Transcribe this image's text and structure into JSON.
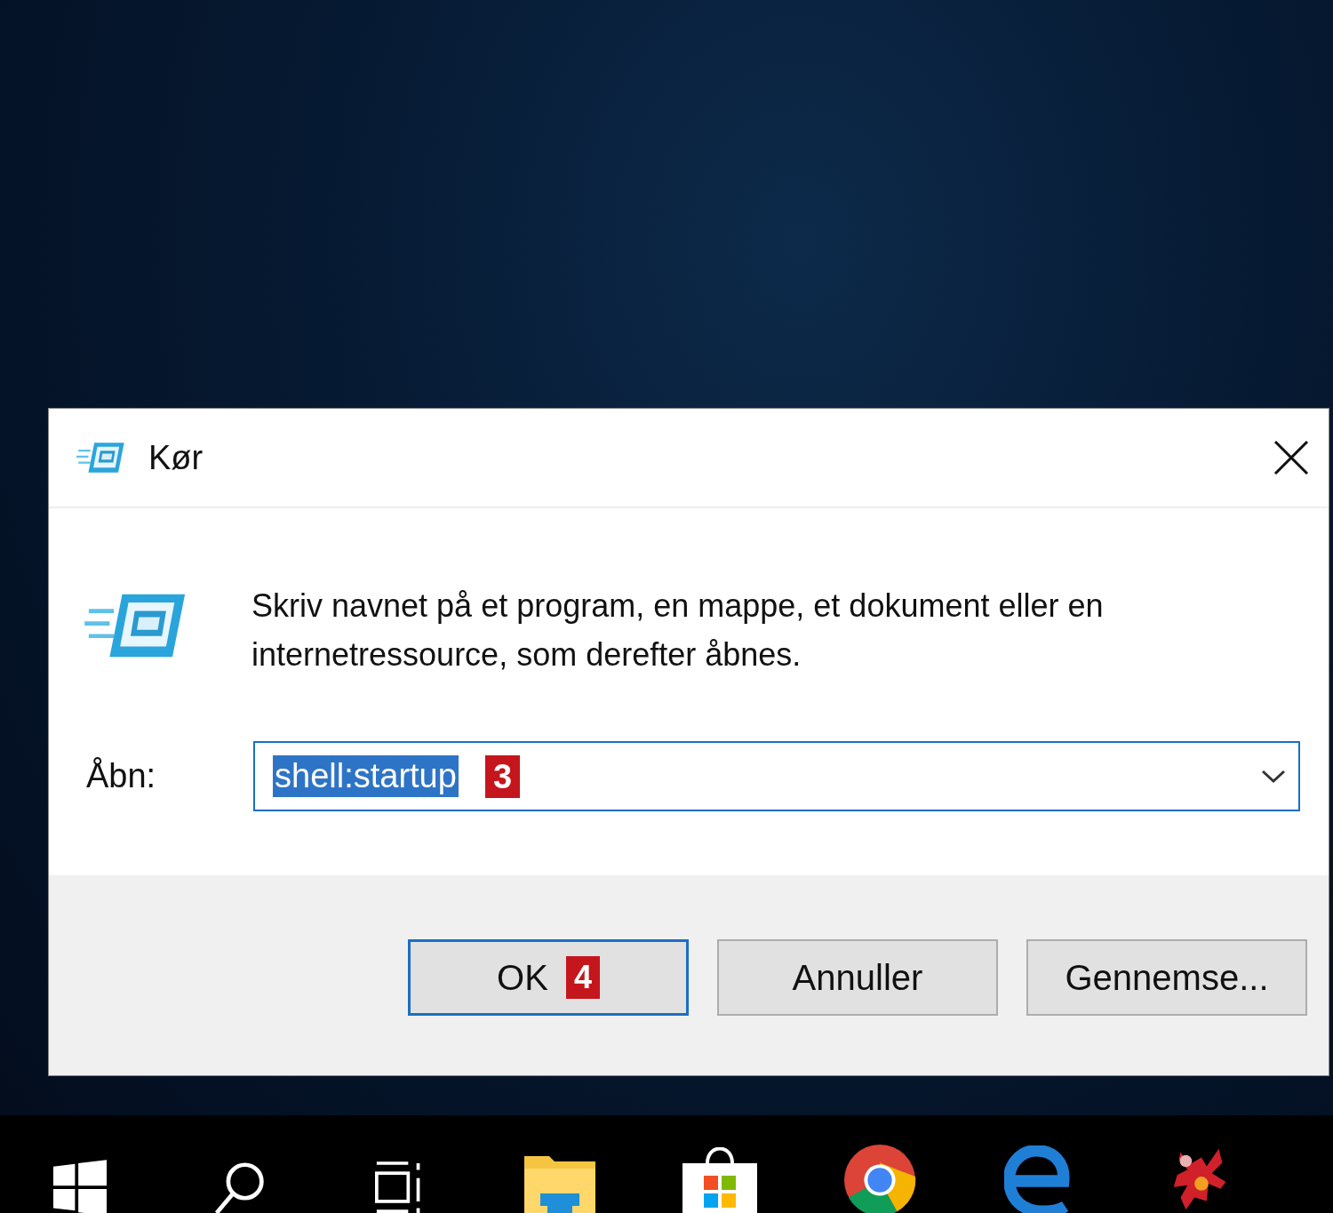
{
  "window": {
    "title": "Kør"
  },
  "dialog": {
    "description": "Skriv navnet på et program, en mappe, et dokument eller en internetressource, som derefter åbnes.",
    "open_label": "Åbn:",
    "open_field": {
      "value": "shell:startup",
      "selected": true,
      "callout": "3"
    },
    "buttons": [
      {
        "label": "OK",
        "default": true,
        "callout": "4"
      },
      {
        "label": "Annuller",
        "default": false
      },
      {
        "label": "Gennemse...",
        "default": false
      }
    ]
  },
  "taskbar": {
    "items": [
      {
        "kind": "start"
      },
      {
        "kind": "search"
      },
      {
        "kind": "taskview"
      },
      {
        "kind": "folder"
      },
      {
        "kind": "store"
      },
      {
        "kind": "chrome"
      },
      {
        "kind": "edge"
      },
      {
        "kind": "mascot"
      }
    ]
  }
}
